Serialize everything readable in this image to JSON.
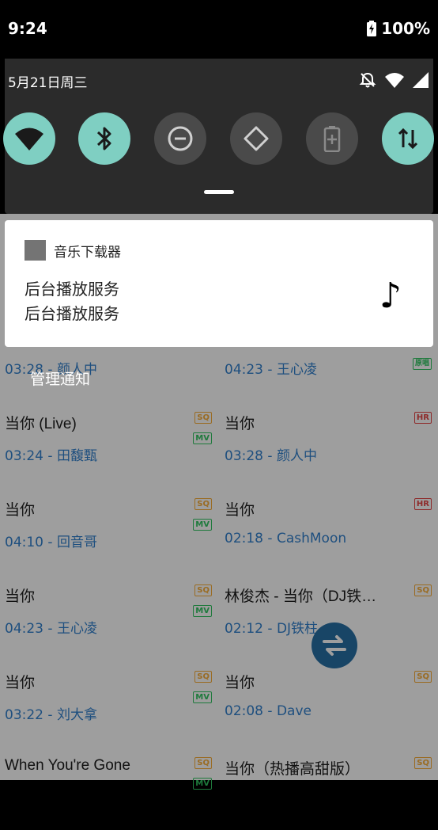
{
  "status_bar": {
    "time": "9:24",
    "battery": "100%"
  },
  "quick_settings": {
    "date": "5月21日周三",
    "tiles": [
      {
        "name": "wifi",
        "state": "on"
      },
      {
        "name": "bluetooth",
        "state": "on"
      },
      {
        "name": "do-not-disturb",
        "state": "off"
      },
      {
        "name": "auto-rotate",
        "state": "off"
      },
      {
        "name": "battery-saver",
        "state": "off"
      },
      {
        "name": "mobile-data",
        "state": "on"
      }
    ]
  },
  "notification": {
    "app_name": "音乐下载器",
    "line1": "后台播放服务",
    "line2": "后台播放服务"
  },
  "manage_notifications": "管理通知",
  "songs_left": [
    {
      "title": "",
      "duration": "03:28",
      "artist": "颜人中",
      "badges": []
    },
    {
      "title": "当你 (Live)",
      "duration": "03:24",
      "artist": "田馥甄",
      "badges": [
        "SQ",
        "MV"
      ]
    },
    {
      "title": "当你",
      "duration": "04:10",
      "artist": "回音哥",
      "badges": [
        "SQ",
        "MV"
      ]
    },
    {
      "title": "当你",
      "duration": "04:23",
      "artist": "王心凌",
      "badges": [
        "SQ",
        "MV"
      ]
    },
    {
      "title": "当你",
      "duration": "03:22",
      "artist": "刘大拿",
      "badges": [
        "SQ",
        "MV"
      ]
    },
    {
      "title": "When You're Gone",
      "duration": "",
      "artist": "",
      "badges": [
        "SQ",
        "MV"
      ]
    }
  ],
  "songs_right": [
    {
      "title": "",
      "duration": "04:23",
      "artist": "王心凌",
      "badges": [
        "原唱"
      ]
    },
    {
      "title": "当你",
      "duration": "03:28",
      "artist": "颜人中",
      "badges": [
        "HR"
      ]
    },
    {
      "title": "当你",
      "duration": "02:18",
      "artist": "CashMoon",
      "badges": [
        "HR"
      ]
    },
    {
      "title": "林俊杰 - 当你（DJ铁…",
      "duration": "02:12",
      "artist": "DJ铁柱",
      "badges": [
        "SQ"
      ]
    },
    {
      "title": "当你",
      "duration": "02:08",
      "artist": "Dave",
      "badges": [
        "SQ"
      ]
    },
    {
      "title": "当你（热播高甜版）",
      "duration": "",
      "artist": "",
      "badges": [
        "SQ"
      ]
    }
  ]
}
